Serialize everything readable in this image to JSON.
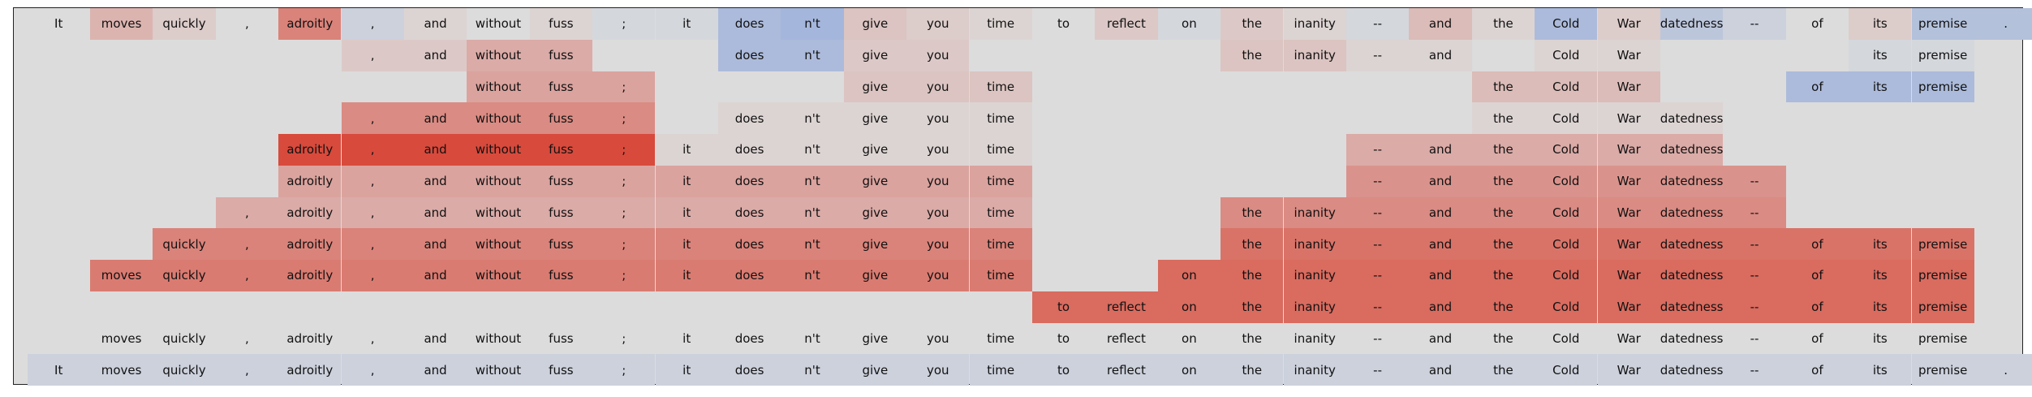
{
  "chart_data": {
    "type": "heatmap",
    "title": "",
    "colors": {
      "background": "#dcdcdc",
      "negative": "#3b6fd8",
      "positive": "#d83a2a"
    },
    "columns": [
      "It",
      "moves",
      "quickly",
      ",",
      "adroitly",
      ",",
      "and",
      "without",
      "fuss",
      ";",
      "it",
      "does",
      "n't",
      "give",
      "you",
      "time",
      "to",
      "reflect",
      "on",
      "the",
      "inanity",
      "--",
      "and",
      "the",
      "Cold",
      "War",
      "datedness",
      "--",
      "of",
      "its",
      "premise",
      "."
    ],
    "rows": [
      {
        "spans": [
          [
            0,
            31
          ]
        ],
        "values": [
          0,
          0.25,
          0.1,
          0,
          0.55,
          -0.1,
          0.05,
          0,
          0.05,
          -0.05,
          -0.05,
          -0.3,
          -0.35,
          0.15,
          0.1,
          0.05,
          0,
          0.12,
          -0.05,
          0.12,
          0.05,
          -0.05,
          0.2,
          0.05,
          -0.3,
          0.1,
          -0.2,
          -0.1,
          0,
          0.1,
          -0.25,
          -0.25
        ]
      },
      {
        "spans": [
          [
            5,
            8
          ],
          [
            11,
            14
          ],
          [
            19,
            22
          ],
          [
            24,
            25
          ],
          [
            29,
            30
          ]
        ],
        "values": [
          0,
          0,
          0,
          0,
          0,
          0.12,
          0.12,
          0.3,
          0.3,
          0,
          0,
          -0.3,
          -0.3,
          0.12,
          0.12,
          0,
          0,
          0,
          0,
          0.15,
          0.15,
          0.05,
          0.05,
          0,
          0.05,
          0.05,
          0,
          0,
          0,
          -0.05,
          -0.05,
          0
        ]
      },
      {
        "spans": [
          [
            7,
            9
          ],
          [
            13,
            15
          ],
          [
            23,
            25
          ],
          [
            28,
            30
          ]
        ],
        "values": [
          0,
          0,
          0,
          0,
          0,
          0,
          0,
          0.35,
          0.35,
          0.35,
          0,
          0,
          0,
          0.15,
          0.15,
          0.15,
          0,
          0,
          0,
          0,
          0,
          0,
          0,
          0.2,
          0.2,
          0.2,
          0,
          0,
          -0.3,
          -0.3,
          -0.3,
          0
        ]
      },
      {
        "spans": [
          [
            5,
            9
          ],
          [
            11,
            15
          ],
          [
            23,
            26
          ]
        ],
        "values": [
          0,
          0,
          0,
          0,
          0,
          0.5,
          0.5,
          0.5,
          0.5,
          0.5,
          0,
          0.05,
          0.05,
          0.05,
          0.05,
          0.05,
          0,
          0,
          0,
          0,
          0,
          0,
          0,
          0.05,
          0.05,
          0.05,
          0.05,
          0,
          0,
          0,
          0,
          0
        ]
      },
      {
        "spans": [
          [
            4,
            15
          ],
          [
            21,
            26
          ]
        ],
        "values": [
          0,
          0,
          0,
          0,
          0.9,
          0.9,
          0.9,
          0.9,
          0.9,
          0.9,
          0.05,
          0.05,
          0.05,
          0.05,
          0.05,
          0.05,
          0,
          0,
          0,
          0,
          0,
          0.3,
          0.3,
          0.3,
          0.3,
          0.3,
          0.3,
          0,
          0,
          0,
          0,
          0
        ]
      },
      {
        "spans": [
          [
            4,
            15
          ],
          [
            21,
            27
          ]
        ],
        "values": [
          0,
          0,
          0,
          0,
          0.35,
          0.35,
          0.35,
          0.35,
          0.35,
          0.35,
          0.35,
          0.35,
          0.35,
          0.35,
          0.35,
          0.35,
          0,
          0,
          0,
          0,
          0,
          0.45,
          0.45,
          0.45,
          0.45,
          0.45,
          0.45,
          0.45,
          0,
          0,
          0,
          0
        ]
      },
      {
        "spans": [
          [
            3,
            15
          ],
          [
            19,
            27
          ]
        ],
        "values": [
          0,
          0,
          0,
          0.3,
          0.3,
          0.3,
          0.3,
          0.3,
          0.3,
          0.3,
          0.3,
          0.3,
          0.3,
          0.3,
          0.3,
          0.3,
          0,
          0,
          0,
          0.5,
          0.5,
          0.5,
          0.5,
          0.5,
          0.5,
          0.5,
          0.5,
          0.5,
          0,
          0,
          0,
          0
        ]
      },
      {
        "spans": [
          [
            2,
            15
          ],
          [
            19,
            30
          ]
        ],
        "values": [
          0,
          0,
          0.55,
          0.55,
          0.55,
          0.55,
          0.55,
          0.55,
          0.55,
          0.55,
          0.55,
          0.55,
          0.55,
          0.55,
          0.55,
          0.55,
          0,
          0,
          0,
          0.65,
          0.65,
          0.65,
          0.65,
          0.65,
          0.65,
          0.65,
          0.65,
          0.65,
          0.65,
          0.65,
          0.65,
          0
        ]
      },
      {
        "spans": [
          [
            1,
            15
          ],
          [
            18,
            30
          ]
        ],
        "values": [
          0,
          0.6,
          0.6,
          0.6,
          0.6,
          0.6,
          0.6,
          0.6,
          0.6,
          0.6,
          0.6,
          0.6,
          0.6,
          0.6,
          0.6,
          0.6,
          0,
          0,
          0.7,
          0.7,
          0.7,
          0.7,
          0.7,
          0.7,
          0.7,
          0.7,
          0.7,
          0.7,
          0.7,
          0.7,
          0.7,
          0
        ]
      },
      {
        "spans": [
          [
            16,
            30
          ]
        ],
        "values": [
          0,
          0,
          0,
          0,
          0,
          0,
          0,
          0,
          0,
          0,
          0,
          0,
          0,
          0,
          0,
          0,
          0.7,
          0.7,
          0.7,
          0.7,
          0.7,
          0.7,
          0.7,
          0.7,
          0.7,
          0.7,
          0.7,
          0.7,
          0.7,
          0.7,
          0.7,
          0
        ]
      },
      {
        "spans": [
          [
            1,
            30
          ]
        ],
        "values": [
          0,
          0,
          0,
          0,
          0,
          0,
          0,
          0,
          0,
          0,
          0,
          0,
          0,
          0,
          0,
          0,
          0,
          0,
          0,
          0,
          0,
          0,
          0,
          0,
          0,
          0,
          0,
          0,
          0,
          0,
          0,
          0
        ]
      },
      {
        "spans": [
          [
            0,
            31
          ]
        ],
        "values": [
          -0.1,
          -0.1,
          -0.1,
          -0.1,
          -0.1,
          -0.1,
          -0.1,
          -0.1,
          -0.1,
          -0.1,
          -0.1,
          -0.1,
          -0.1,
          -0.1,
          -0.1,
          -0.1,
          -0.1,
          -0.1,
          -0.1,
          -0.1,
          -0.1,
          -0.1,
          -0.1,
          -0.1,
          -0.1,
          -0.1,
          -0.1,
          -0.1,
          -0.1,
          -0.1,
          -0.1,
          -0.1
        ]
      }
    ]
  }
}
